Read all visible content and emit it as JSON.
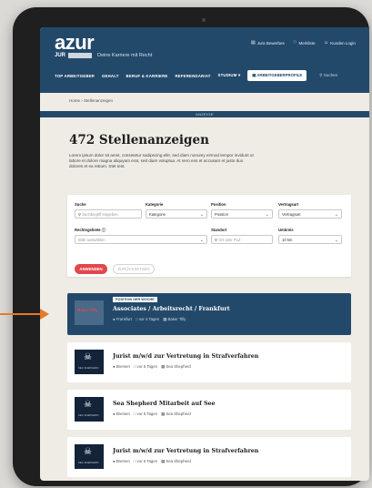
{
  "header": {
    "logo": "azur",
    "logo_sub": "JUR",
    "logo_bar": "",
    "tagline": "Deine Karriere mit Recht",
    "util": [
      {
        "icon": "document-icon",
        "label": "Jura Bewerbes"
      },
      {
        "icon": "heart-icon",
        "label": "Merkliste"
      },
      {
        "icon": "user-icon",
        "label": "Kunden Login"
      }
    ],
    "nav": [
      "TOP ARBEITGEBER",
      "GEHALT",
      "BERUF & KARRIERE",
      "REFERENDARIAT",
      "STUDIUM ▾"
    ],
    "nav_button": "ARBEITGEBERPROFILE",
    "search_placeholder": "Suchen"
  },
  "breadcrumb": "Home › Stellenanzeigen",
  "banner": "ANZEIGE",
  "page_title": "472 Stellenanzeigen",
  "intro": "Lorem ipsum dolor sit amet, consetetur sadipscing elitr, sed diam nonumy eirmod tempor invidunt ut labore et dolore magna aliquyam erat, sed diam voluptua. At vero eos et accusam et justo duo dolores et ea rebum. Stet test.",
  "filters": {
    "suche_label": "Suche",
    "suche_placeholder": "Suchbegriff eingeben",
    "kategorie_label": "Kategorie",
    "kategorie_value": "Kategorie",
    "position_label": "Position",
    "position_value": "Position",
    "vertragsart_label": "Vertragsart",
    "vertragsart_value": "Vertragsart",
    "rechtsgebiete_label": "Rechtsgebiete ⓘ",
    "rechtsgebiete_placeholder": "Bitte auswählen",
    "standort_label": "Standort",
    "standort_placeholder": "Ort oder PLZ",
    "umkreis_label": "Umkreis",
    "umkreis_value": "10 km",
    "primary_button": "ANWENDEN",
    "secondary_button": "ZURÜCKSETZEN"
  },
  "jobs": [
    {
      "badge": "POSITION DER WOCHE",
      "title": "Associates / Arbeitsrecht / Frankfurt",
      "location": "Frankfurt",
      "age": "vor 4 Tagen",
      "company": "Baker Tilly",
      "logo_text": "Baker Tilly"
    },
    {
      "title": "Jurist m/w/d zur Vertretung in Strafverfahren",
      "location": "Bremen",
      "age": "vor 5 Tagen",
      "company": "Sea Shepherd",
      "logo_text": "SEA SHEPHERD"
    },
    {
      "title": "Sea Shepherd Mitarbeit auf See",
      "location": "Bremen",
      "age": "vor 5 Tagen",
      "company": "Sea Shepherd",
      "logo_text": "SEA SHEPHERD"
    },
    {
      "title": "Jurist m/w/d zur Vertretung in Strafverfahren",
      "location": "Bremen",
      "age": "vor 5 Tagen",
      "company": "Sea Shepherd",
      "logo_text": "SEA SHEPHERD"
    }
  ],
  "colors": {
    "brand": "#23496a",
    "accent": "#e3474b",
    "arrow": "#e67a25"
  }
}
